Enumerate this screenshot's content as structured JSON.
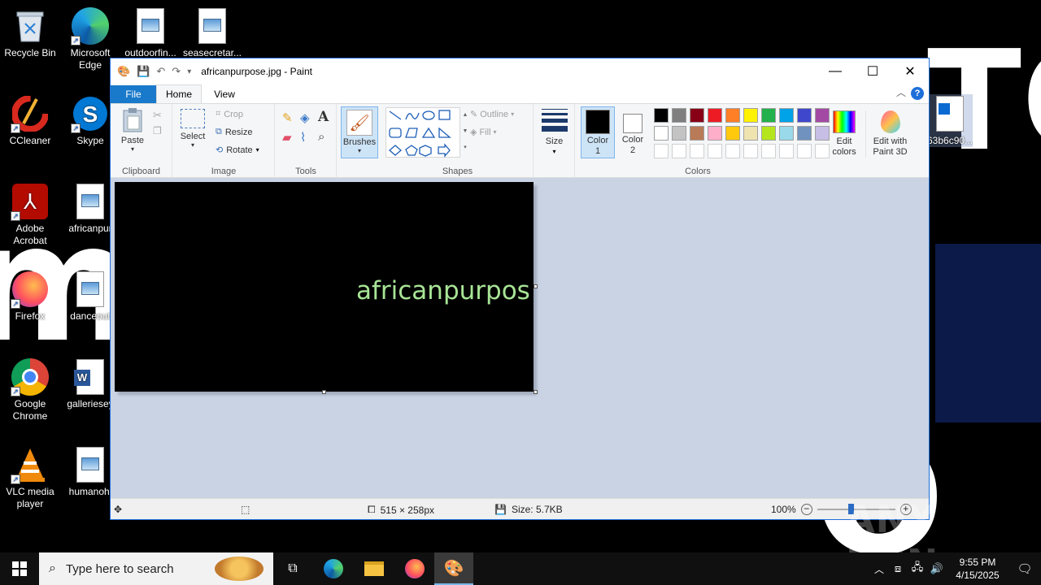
{
  "desktop": {
    "icons": [
      {
        "label": "Recycle Bin"
      },
      {
        "label": "Microsoft Edge"
      },
      {
        "label": "outdoorfin..."
      },
      {
        "label": "seasecretar..."
      },
      {
        "label": "CCleaner"
      },
      {
        "label": "Skype"
      },
      {
        "label": "Adobe Acrobat"
      },
      {
        "label": "africanpur"
      },
      {
        "label": "Firefox"
      },
      {
        "label": "danceout"
      },
      {
        "label": "Google Chrome"
      },
      {
        "label": "galleriesey"
      },
      {
        "label": "VLC media player"
      },
      {
        "label": "humanohi"
      }
    ],
    "partial_icon_label": "63b6c90..."
  },
  "paint": {
    "title": "africanpurpose.jpg - Paint",
    "tabs": {
      "file": "File",
      "home": "Home",
      "view": "View"
    },
    "help": "?",
    "clipboard": {
      "paste": "Paste",
      "group": "Clipboard"
    },
    "image": {
      "select": "Select",
      "crop": "Crop",
      "resize": "Resize",
      "rotate": "Rotate",
      "group": "Image"
    },
    "tools": {
      "group": "Tools"
    },
    "brushes": {
      "label": "Brushes"
    },
    "shapes": {
      "outline": "Outline",
      "fill": "Fill",
      "group": "Shapes"
    },
    "size": {
      "label": "Size"
    },
    "colors": {
      "color1": "Color\n1",
      "color2": "Color\n2",
      "edit_colors": "Edit\ncolors",
      "edit_paint3d": "Edit with\nPaint 3D",
      "group": "Colors",
      "color1_value": "#000000",
      "color2_value": "#ffffff",
      "palette_row1": [
        "#000000",
        "#7f7f7f",
        "#880015",
        "#ed1c24",
        "#ff7f27",
        "#fff200",
        "#22b14c",
        "#00a2e8",
        "#3f48cc",
        "#a349a4"
      ],
      "palette_row2": [
        "#ffffff",
        "#c3c3c3",
        "#b97a57",
        "#ffaec9",
        "#ffc90e",
        "#efe4b0",
        "#b5e61d",
        "#99d9ea",
        "#7092be",
        "#c8bfe7"
      ]
    },
    "canvas": {
      "text": "africanpurpos",
      "text_color": "#a8e496"
    },
    "status": {
      "dimensions": "515 × 258px",
      "size": "Size: 5.7KB",
      "zoom": "100%"
    }
  },
  "taskbar": {
    "search_placeholder": "Type here to search",
    "time": "9:55 PM",
    "date": "4/15/2025"
  },
  "watermark": "ANY RUN"
}
